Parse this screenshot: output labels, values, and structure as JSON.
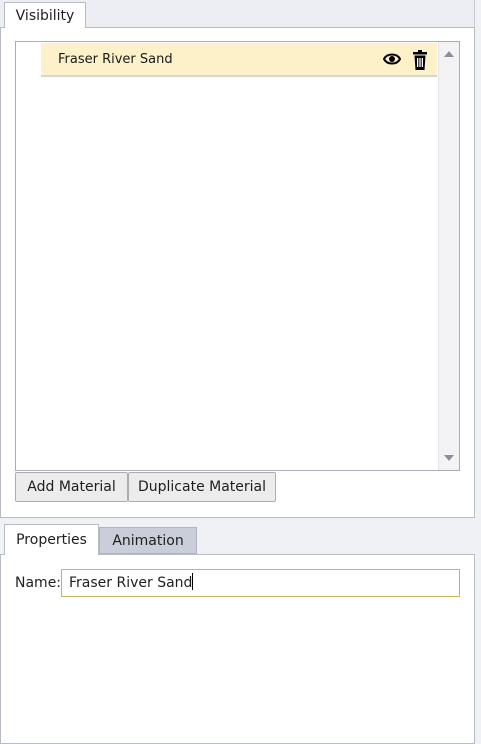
{
  "top_panel": {
    "tab_label": "Visibility",
    "materials": [
      {
        "name": "Fraser River Sand",
        "icons": [
          "eye-icon",
          "trash-icon"
        ],
        "selected": true
      }
    ],
    "buttons": {
      "add": "Add Material",
      "duplicate": "Duplicate Material"
    }
  },
  "bottom_panel": {
    "tabs": [
      {
        "label": "Properties",
        "active": true
      },
      {
        "label": "Animation",
        "active": false
      }
    ],
    "name_label": "Name:",
    "name_value": "Fraser River Sand"
  },
  "colors": {
    "selected_row": "#fcf1c8",
    "input_border_focus": "#c9b45a",
    "inactive_tab": "#c9ced8"
  }
}
